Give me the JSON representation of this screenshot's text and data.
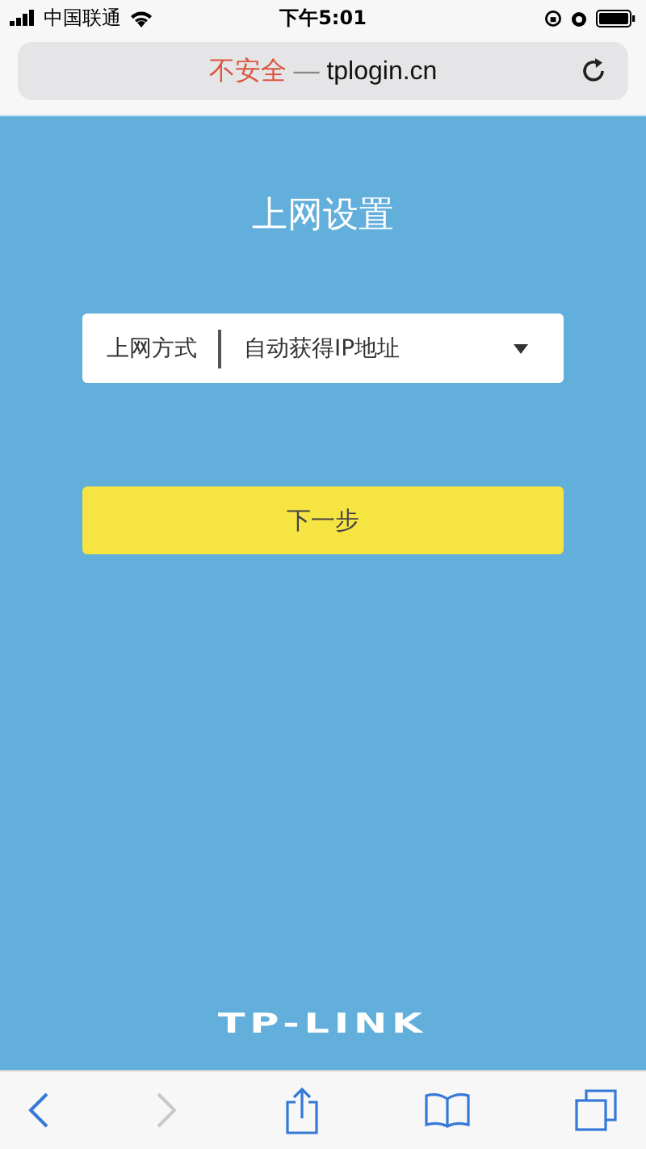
{
  "status_bar": {
    "carrier": "中国联通",
    "time": "下午5:01"
  },
  "address_bar": {
    "warning": "不安全",
    "separator": "—",
    "url": "tplogin.cn"
  },
  "page": {
    "title": "上网设置",
    "field": {
      "label": "上网方式",
      "value": "自动获得IP地址"
    },
    "button": "下一步",
    "logo": "TP-LINK"
  },
  "toolbar": {
    "back_disabled": false,
    "forward_disabled": true
  }
}
